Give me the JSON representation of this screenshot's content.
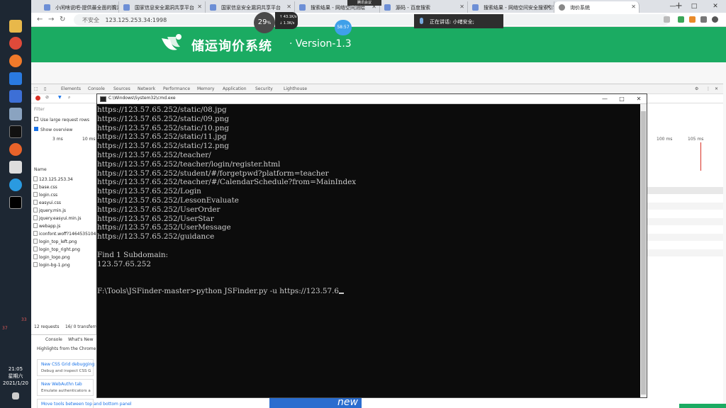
{
  "browser": {
    "tabs": [
      {
        "label": "小闲啥说吧-提供最全面的漏洞"
      },
      {
        "label": "国家信息安全漏洞共享平台"
      },
      {
        "label": "国家信息安全漏洞共享平台"
      },
      {
        "label": "搜索结果 - 网络空间测绘"
      },
      {
        "label": "源码 - 百度搜索"
      },
      {
        "label": "搜索结果 - 网络空间安全搜索引擎"
      },
      {
        "label": "询价系统"
      }
    ],
    "new_tab_label": "+",
    "address_warning": "不安全",
    "address_url": "123.125.253.34:1998",
    "window_minimize": "—",
    "window_maximize": "□",
    "window_close": "✕"
  },
  "overlays": {
    "speed_value": "29",
    "speed_unit": "%",
    "net_up": "↑ 43.1K/s",
    "net_down": "↓ 1.3K/s",
    "bubble_value": "58:57",
    "speaker_text": "正在讲话: 小绪安全;",
    "meeting_label": "腾讯会议",
    "promo_text": "new"
  },
  "page": {
    "title": "储运询价系统",
    "separator": "·",
    "version": "Version-1.3"
  },
  "devtools": {
    "tabs": [
      "Elements",
      "Console",
      "Sources",
      "Network",
      "Performance",
      "Memory",
      "Application",
      "Security",
      "Lighthouse"
    ],
    "filter_placeholder": "Filter",
    "opt_large_rows": "Use large request rows",
    "opt_overview": "Show overview",
    "tl_labels": [
      "3 ms",
      "10 ms",
      "100 ms",
      "105 ms"
    ],
    "name_header": "Name",
    "files": [
      "123.125.253.34",
      "base.css",
      "login.css",
      "easyui.css",
      "jquery.min.js",
      "jquery.easyui.min.js",
      "webapp.js",
      "iconfont.woff?1464535104",
      "login_top_left.png",
      "login_top_right.png",
      "login_logo.png",
      "login-bg-1.png"
    ],
    "requests_status": "12 requests",
    "transferred_status": "16/ 0 transferred",
    "drawer_tabs": [
      "Console",
      "What's New"
    ],
    "drawer_highlight": "Highlights from the Chrome 8",
    "cards": [
      {
        "title": "New CSS Grid debugging",
        "desc": "Debug and inspect CSS G"
      },
      {
        "title": "New WebAuthn tab",
        "desc": "Emulate authenticators a"
      },
      {
        "title": "Move tools between top and bottom panel",
        "desc": ""
      }
    ]
  },
  "cmd": {
    "title": "C:\\Windows\\System32\\cmd.exe",
    "lines": [
      "https://123.57.65.252/static/08.jpg",
      "https://123.57.65.252/static/09.png",
      "https://123.57.65.252/static/10.png",
      "https://123.57.65.252/static/11.jpg",
      "https://123.57.65.252/static/12.png",
      "https://123.57.65.252/teacher/",
      "https://123.57.65.252/teacher/login/register.html",
      "https://123.57.65.252/student/#/forgetpwd?platform=teacher",
      "https://123.57.65.252/teacher/#/CalendarSchedule?from=MainIndex",
      "https://123.57.65.252/Login",
      "https://123.57.65.252/LessonEvaluate",
      "https://123.57.65.252/UserOrder",
      "https://123.57.65.252/UserStar",
      "https://123.57.65.252/UserMessage",
      "https://123.57.65.252/guidance",
      "",
      "Find 1 Subdomain:",
      "123.57.65.252",
      "",
      ""
    ],
    "prompt": "F:\\Tools\\JSFinder-master>python JSFinder.py -u https://123.57.6"
  },
  "taskbar": {
    "tray_nums": [
      "33",
      "37"
    ],
    "time": "21:05",
    "weekday": "星期六",
    "date": "2021/1/20"
  },
  "colors": {
    "brand_green": "#1bab62",
    "cmd_bg": "#0c0c0c",
    "cmd_text": "#cccccc"
  }
}
